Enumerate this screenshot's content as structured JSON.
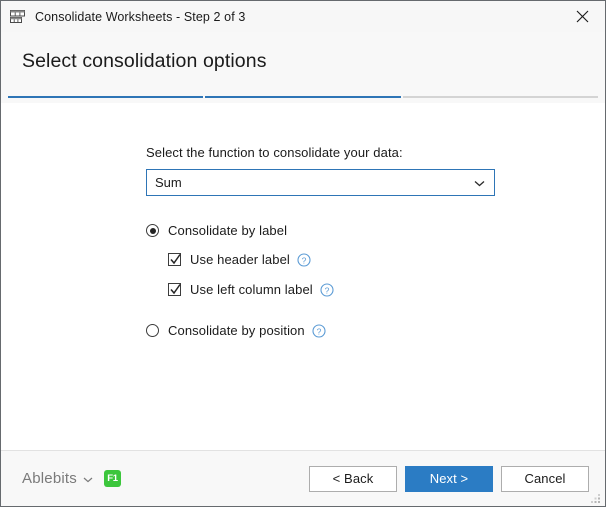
{
  "window": {
    "title": "Consolidate Worksheets - Step 2 of 3",
    "icon": "worksheet-grid-icon",
    "close_label": "Close"
  },
  "header": {
    "page_title": "Select consolidation options"
  },
  "progress": {
    "total_steps": 3,
    "current_step": 2,
    "completed_color": "#2e75b6",
    "remaining_color": "#d4d4d4",
    "segments": [
      "done",
      "done",
      "todo"
    ]
  },
  "form": {
    "function_label": "Select the function to consolidate your data:",
    "function_select": {
      "value": "Sum",
      "focused": true,
      "border_color": "#2e75b6",
      "arrow_icon": "chevron-down-icon"
    },
    "options": [
      {
        "id": "consolidate-by-label",
        "type": "radio",
        "label": "Consolidate by label",
        "checked": true,
        "help": false
      },
      {
        "id": "use-header-label",
        "type": "checkbox",
        "label": "Use header label",
        "checked": true,
        "help": true,
        "indent": true
      },
      {
        "id": "use-left-column-label",
        "type": "checkbox",
        "label": "Use left column label",
        "checked": true,
        "help": true,
        "indent": true
      },
      {
        "id": "consolidate-by-position",
        "type": "radio",
        "label": "Consolidate by position",
        "checked": false,
        "help": true
      }
    ],
    "help_icon": "question-mark-circle-icon",
    "help_icon_color": "#5b9bd5"
  },
  "footer": {
    "brand": "Ablebits",
    "brand_chevron": "chevron-down-icon",
    "shortcut_badge": "F1",
    "shortcut_badge_color": "#3cc63c",
    "buttons": {
      "back": "< Back",
      "next": "Next >",
      "cancel": "Cancel"
    },
    "primary_button_color": "#2b7cc4",
    "resize_grip": "resize-grip-icon"
  }
}
